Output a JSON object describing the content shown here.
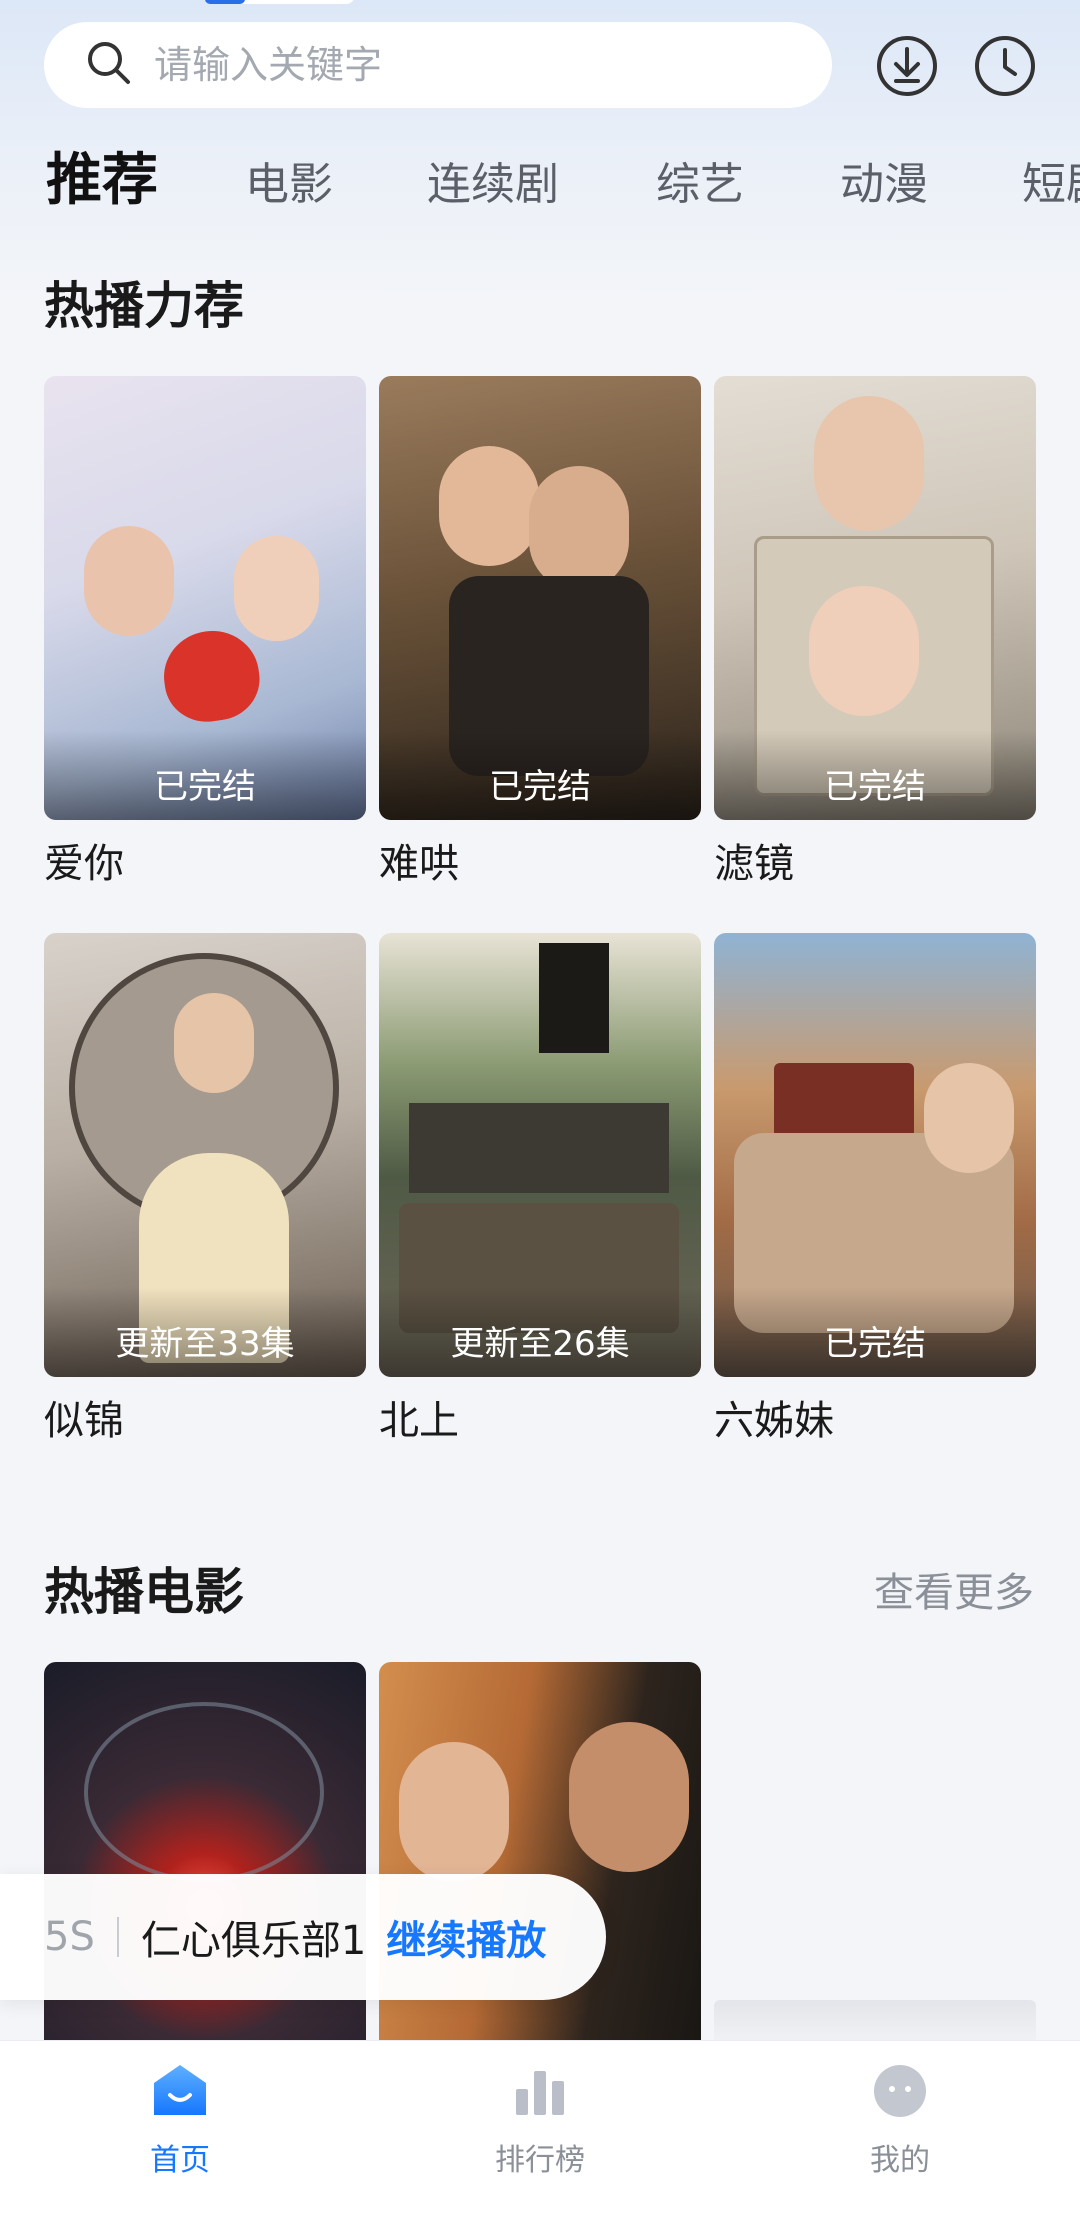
{
  "search": {
    "placeholder": "请输入关键字"
  },
  "header_icons": [
    "download-icon",
    "history-clock-icon"
  ],
  "tabs": [
    {
      "label": "推荐",
      "active": true
    },
    {
      "label": "电影"
    },
    {
      "label": "连续剧"
    },
    {
      "label": "综艺"
    },
    {
      "label": "动漫"
    },
    {
      "label": "短剧"
    }
  ],
  "hot_series": {
    "title": "热播力荐",
    "items": [
      {
        "title": "爱你",
        "badge": "已完结"
      },
      {
        "title": "难哄",
        "badge": "已完结"
      },
      {
        "title": "滤镜",
        "badge": "已完结"
      },
      {
        "title": "似锦",
        "badge": "更新至33集"
      },
      {
        "title": "北上",
        "badge": "更新至26集"
      },
      {
        "title": "六姊妹",
        "badge": "已完结"
      }
    ]
  },
  "hot_movies": {
    "title": "热播电影",
    "more_label": "查看更多"
  },
  "resume": {
    "episode": "5S",
    "name": "仁心俱乐部1",
    "action": "继续播放"
  },
  "nav": [
    {
      "label": "首页",
      "icon": "home-icon",
      "active": true
    },
    {
      "label": "排行榜",
      "icon": "ranking-chart-icon"
    },
    {
      "label": "我的",
      "icon": "profile-face-icon"
    }
  ],
  "colors": {
    "accent": "#1677ff",
    "background": "#f3f5f9"
  }
}
